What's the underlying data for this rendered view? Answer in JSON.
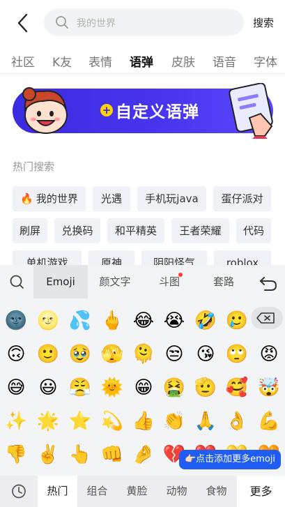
{
  "header": {
    "search_placeholder": "我的世界",
    "search_button": "搜索"
  },
  "tabs": [
    "社区",
    "K友",
    "表情",
    "语弹",
    "皮肤",
    "语音",
    "字体"
  ],
  "active_tab": "语弹",
  "banner": {
    "label": "自定义语弹"
  },
  "hot_search": {
    "title": "热门搜索",
    "items": [
      "我的世界",
      "光遇",
      "手机玩java",
      "蛋仔派对",
      "刷屏",
      "兑换码",
      "和平精英",
      "王者荣耀",
      "代码",
      "单机游戏",
      "原神",
      "阴阳怪气",
      "roblox"
    ]
  },
  "keyboard": {
    "tabs": [
      "Emoji",
      "颜文字",
      "斗图",
      "套路"
    ],
    "active_tab": "Emoji",
    "emojis": [
      [
        "🌚",
        "🌝",
        "💦",
        "🖕",
        "😂",
        "😭",
        "🤣",
        "🥲"
      ],
      [
        "🙃",
        "🙂",
        "🥹",
        "🫣",
        "🫠",
        "😒",
        "😘",
        "🙄",
        "😡"
      ],
      [
        "😅",
        "😃",
        "😤",
        "🌞",
        "😁",
        "🤮",
        "🫡",
        "🥰",
        "🤯"
      ],
      [
        "✨",
        "🌟",
        "⭐",
        "💫",
        "👍",
        "👏",
        "🙏",
        "👌",
        "💪"
      ],
      [
        "👎",
        "✌️",
        "👆",
        "👊",
        "🤌",
        "💔",
        "❤️",
        "💛",
        "🧡"
      ],
      [
        "💚",
        "💙",
        "💜",
        "🖤",
        "💗",
        "💖",
        "💝",
        "💓",
        "💞"
      ]
    ],
    "tip": "👉🏻点击添加更多emoji",
    "categories": [
      "热门",
      "组合",
      "黄脸",
      "动物",
      "食物"
    ],
    "active_category": "热门",
    "more": "更多"
  }
}
